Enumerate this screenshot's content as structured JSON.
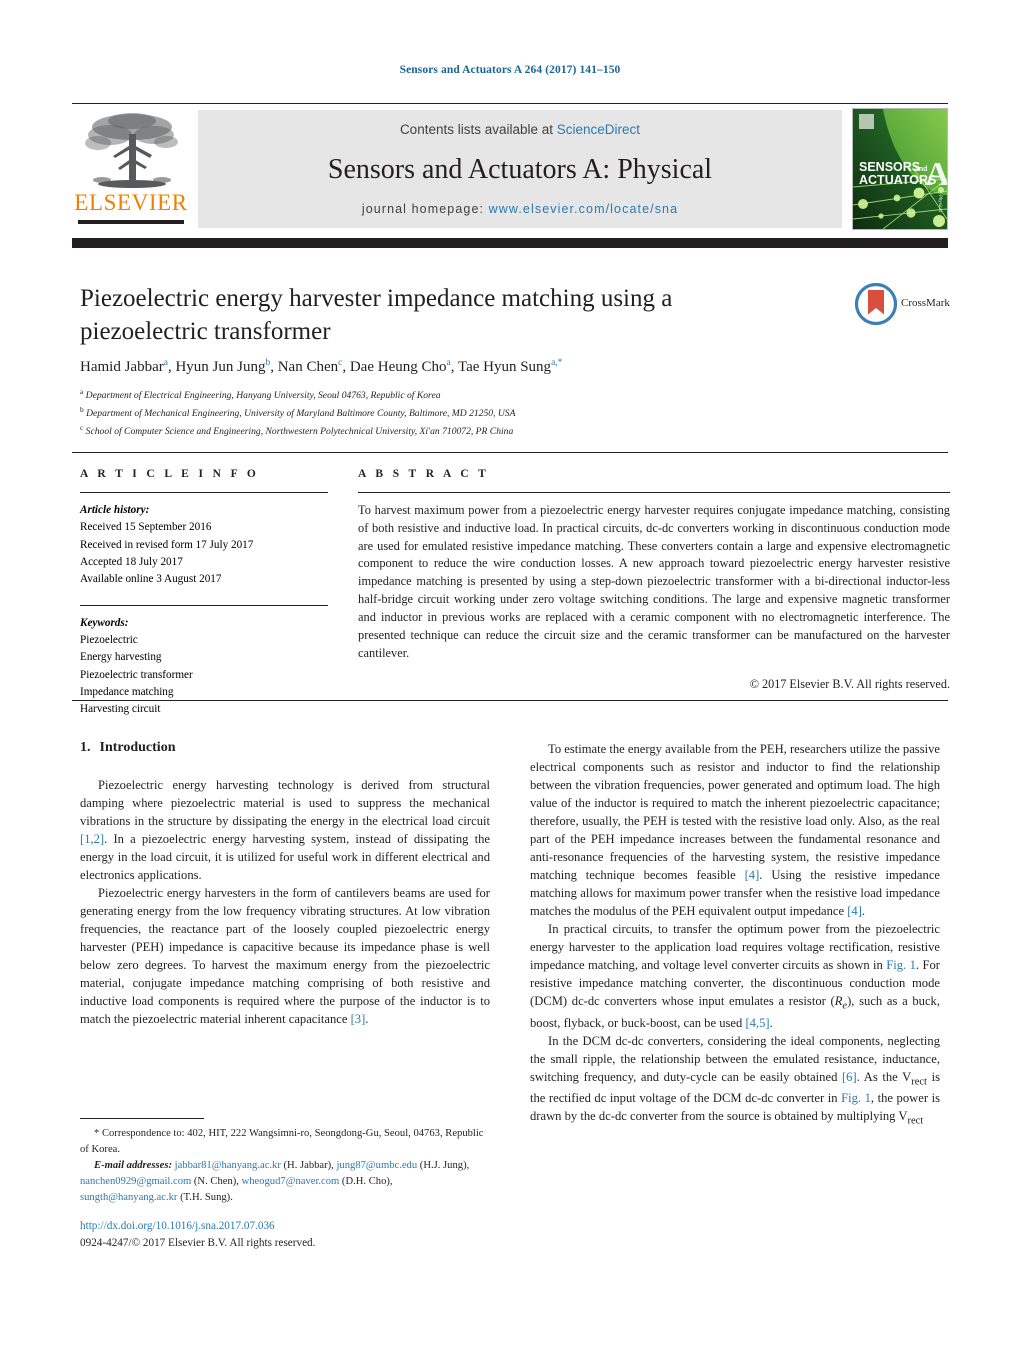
{
  "running_head": "Sensors and Actuators A 264 (2017) 141–150",
  "masthead": {
    "contents_prefix": "Contents lists available at ",
    "sciencedirect": "ScienceDirect",
    "journal_title": "Sensors and Actuators A: Physical",
    "homepage_prefix": "journal homepage: ",
    "homepage_url": "www.elsevier.com/locate/sna",
    "publisher": "ELSEVIER",
    "cover": {
      "line1": "SENSORS",
      "line1_small": "and",
      "line2": "ACTUATORS",
      "big_letter": "A",
      "side_text": "Physical"
    },
    "colors": {
      "link": "#2a7ab0",
      "elsevier_orange": "#f08000",
      "box_gray": "#e6e6e6",
      "cover_green": "#4caf1e"
    }
  },
  "crossmark": {
    "label": "CrossMark"
  },
  "article": {
    "title": "Piezoelectric energy harvester impedance matching using a piezoelectric transformer",
    "authors_html": "Hamid Jabbar<sup>a</sup>, Hyun Jun Jung<sup>b</sup>, Nan Chen<sup>c</sup>, Dae Heung Cho<sup>a</sup>, Tae Hyun Sung<sup>a,*</sup>",
    "affiliations": [
      {
        "marker": "a",
        "text": "Department of Electrical Engineering, Hanyang University, Seoul 04763, Republic of Korea"
      },
      {
        "marker": "b",
        "text": "Department of Mechanical Engineering, University of Maryland Baltimore County, Baltimore, MD 21250, USA"
      },
      {
        "marker": "c",
        "text": "School of Computer Science and Engineering, Northwestern Polytechnical University, Xi'an 710072, PR China"
      }
    ]
  },
  "article_info": {
    "heading": "A R T I C L E  I N F O",
    "history_label": "Article history:",
    "history": [
      "Received 15 September 2016",
      "Received in revised form 17 July 2017",
      "Accepted 18 July 2017",
      "Available online 3 August 2017"
    ],
    "keywords_label": "Keywords:",
    "keywords": [
      "Piezoelectric",
      "Energy harvesting",
      "Piezoelectric transformer",
      "Impedance matching",
      "Harvesting circuit"
    ]
  },
  "abstract": {
    "heading": "A B S T R A C T",
    "text": "To harvest maximum power from a piezoelectric energy harvester requires conjugate impedance matching, consisting of both resistive and inductive load. In practical circuits, dc-dc converters working in discontinuous conduction mode are used for emulated resistive impedance matching. These converters contain a large and expensive electromagnetic component to reduce the wire conduction losses. A new approach toward piezoelectric energy harvester resistive impedance matching is presented by using a step-down piezoelectric transformer with a bi-directional inductor-less half-bridge circuit working under zero voltage switching conditions. The large and expensive magnetic transformer and inductor in previous works are replaced with a ceramic component with no electromagnetic interference. The presented technique can reduce the circuit size and the ceramic transformer can be manufactured on the harvester cantilever.",
    "copyright": "© 2017 Elsevier B.V. All rights reserved."
  },
  "body": {
    "section_number": "1.",
    "section_title": "Introduction",
    "left_paragraphs": [
      "Piezoelectric energy harvesting technology is derived from structural damping where piezoelectric material is used to suppress the mechanical vibrations in the structure by dissipating the energy in the electrical load circuit [1,2]. In a piezoelectric energy harvesting system, instead of dissipating the energy in the load circuit, it is utilized for useful work in different electrical and electronics applications.",
      "Piezoelectric energy harvesters in the form of cantilevers beams are used for generating energy from the low frequency vibrating structures. At low vibration frequencies, the reactance part of the loosely coupled piezoelectric energy harvester (PEH) impedance is capacitive because its impedance phase is well below zero degrees. To harvest the maximum energy from the piezoelectric material, conjugate impedance matching comprising of both resistive and inductive load components is required where the purpose of the inductor is to match the piezoelectric material inherent capacitance [3]."
    ],
    "right_paragraphs": [
      "To estimate the energy available from the PEH, researchers utilize the passive electrical components such as resistor and inductor to find the relationship between the vibration frequencies, power generated and optimum load. The high value of the inductor is required to match the inherent piezoelectric capacitance; therefore, usually, the PEH is tested with the resistive load only. Also, as the real part of the PEH impedance increases between the fundamental resonance and anti-resonance frequencies of the harvesting system, the resistive impedance matching technique becomes feasible [4]. Using the resistive impedance matching allows for maximum power transfer when the resistive load impedance matches the modulus of the PEH equivalent output impedance [4].",
      "In practical circuits, to transfer the optimum power from the piezoelectric energy harvester to the application load requires voltage rectification, resistive impedance matching, and voltage level converter circuits as shown in Fig. 1. For resistive impedance matching converter, the discontinuous conduction mode (DCM) dc-dc converters whose input emulates a resistor (Re), such as a buck, boost, flyback, or buck-boost, can be used [4,5].",
      "In the DCM dc-dc converters, considering the ideal components, neglecting the small ripple, the relationship between the emulated resistance, inductance, switching frequency, and duty-cycle can be easily obtained [6]. As the Vrect is the rectified dc input voltage of the DCM dc-dc converter in Fig. 1, the power is drawn by the dc-dc converter from the source is obtained by multiplying Vrect"
    ]
  },
  "footnotes": {
    "correspondence": "* Correspondence to: 402, HIT, 222 Wangsimni-ro, Seongdong-Gu, Seoul, 04763, Republic of Korea.",
    "email_label": "E-mail addresses:",
    "emails": [
      {
        "address": "jabbar81@hanyang.ac.kr",
        "owner": "(H. Jabbar)"
      },
      {
        "address": "jung87@umbc.edu",
        "owner": "(H.J. Jung)"
      },
      {
        "address": "nanchen0929@gmail.com",
        "owner": "(N. Chen)"
      },
      {
        "address": "wheogud7@naver.com",
        "owner": "(D.H. Cho)"
      },
      {
        "address": "sungth@hanyang.ac.kr",
        "owner": "(T.H. Sung)"
      }
    ],
    "doi_url": "http://dx.doi.org/10.1016/j.sna.2017.07.036",
    "issn_line": "0924-4247/© 2017 Elsevier B.V. All rights reserved."
  }
}
